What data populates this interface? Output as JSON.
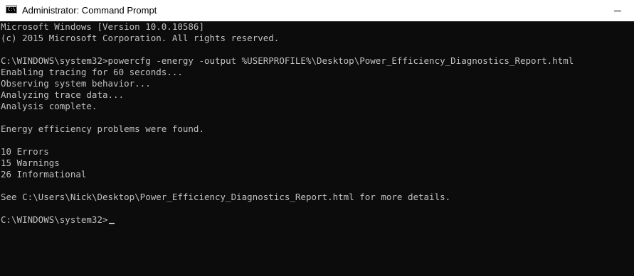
{
  "window": {
    "title": "Administrator: Command Prompt",
    "app_icon_text": "C:\\",
    "controls": [
      "minimize-button"
    ]
  },
  "console": {
    "lines": [
      "Microsoft Windows [Version 10.0.10586]",
      "(c) 2015 Microsoft Corporation. All rights reserved.",
      "",
      "C:\\WINDOWS\\system32>powercfg -energy -output %USERPROFILE%\\Desktop\\Power_Efficiency_Diagnostics_Report.html",
      "Enabling tracing for 60 seconds...",
      "Observing system behavior...",
      "Analyzing trace data...",
      "Analysis complete.",
      "",
      "Energy efficiency problems were found.",
      "",
      "10 Errors",
      "15 Warnings",
      "26 Informational",
      "",
      "See C:\\Users\\Nick\\Desktop\\Power_Efficiency_Diagnostics_Report.html for more details.",
      ""
    ],
    "prompt": "C:\\WINDOWS\\system32>"
  },
  "colors": {
    "background": "#0c0c0c",
    "text": "#c0c0c0",
    "titlebar": "#ffffff"
  }
}
